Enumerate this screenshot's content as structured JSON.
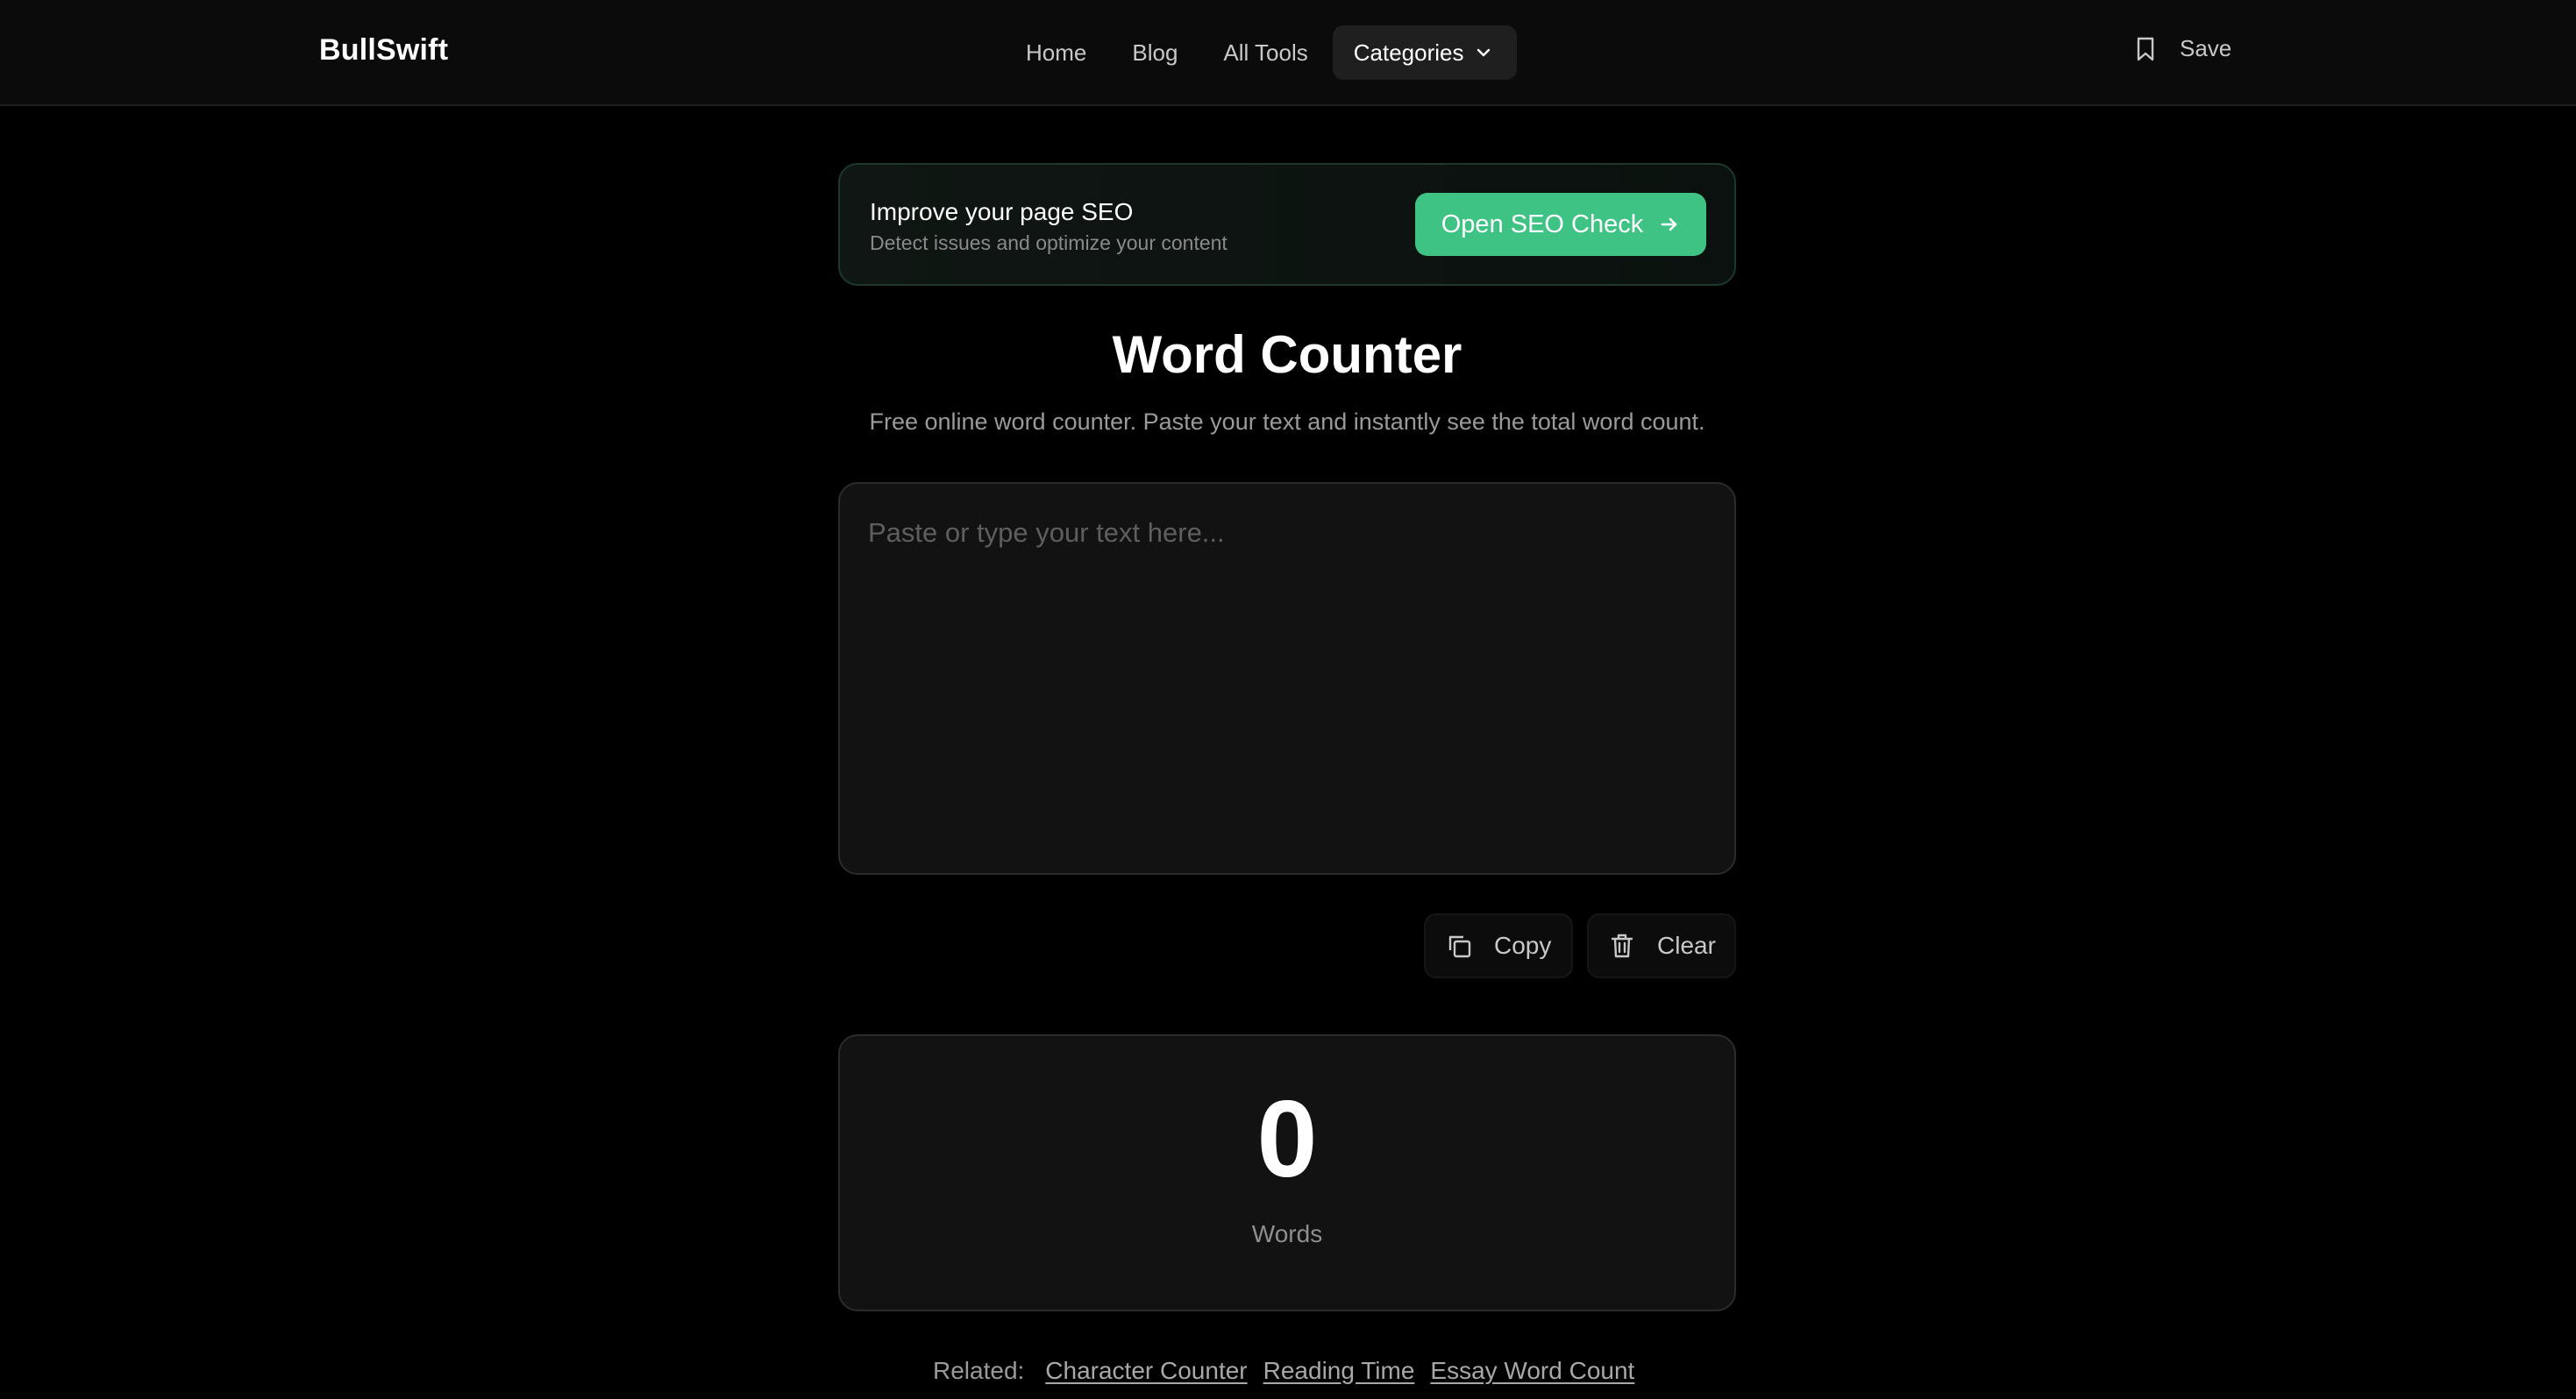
{
  "brand": "BullSwift",
  "nav": {
    "home": "Home",
    "blog": "Blog",
    "all_tools": "All Tools",
    "categories": "Categories"
  },
  "save_label": "Save",
  "banner": {
    "title": "Improve your page SEO",
    "subtitle": "Detect issues and optimize your content",
    "button": "Open SEO Check"
  },
  "page": {
    "title": "Word Counter",
    "subtitle": "Free online word counter. Paste your text and instantly see the total word count."
  },
  "editor": {
    "placeholder": "Paste or type your text here...",
    "value": ""
  },
  "actions": {
    "copy": "Copy",
    "clear": "Clear"
  },
  "stats": {
    "count": "0",
    "label": "Words"
  },
  "related": {
    "label": "Related:",
    "links": [
      "Character Counter",
      "Reading Time",
      "Essay Word Count"
    ]
  },
  "colors": {
    "accent": "#3ec384",
    "background": "#000000",
    "card": "#121212"
  }
}
